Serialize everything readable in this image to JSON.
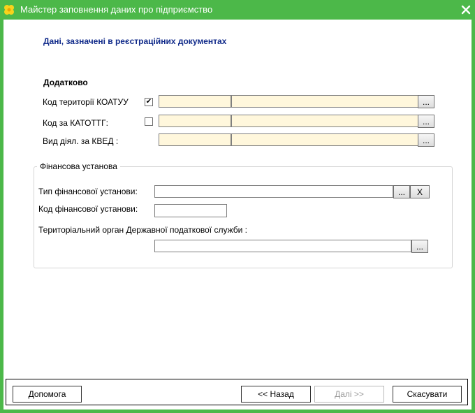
{
  "window": {
    "title": "Майстер заповнення даних про підприємство",
    "icon": "flower-icon",
    "close_glyph": "✕"
  },
  "heading": "Дані, зазначені в реєстраційних документах",
  "additional": {
    "title": "Додатково",
    "koatuu": {
      "label": "Код території КОАТУУ",
      "checked": true,
      "check_glyph": "✔",
      "code": "",
      "name": "",
      "browse_label": "..."
    },
    "katottg": {
      "label": "Код за КАТОТТГ:",
      "checked": false,
      "check_glyph": "",
      "code": "",
      "name": "",
      "browse_label": "..."
    },
    "kved": {
      "label": "Вид діял. за КВЕД :",
      "code": "",
      "name": "",
      "browse_label": "..."
    }
  },
  "financial": {
    "legend": "Фінансова установа",
    "type_label": "Тип фінансової установи:",
    "type_value": "",
    "type_browse_label": "...",
    "type_clear_label": "X",
    "code_label": "Код фінансової установи:",
    "code_value": "",
    "tax_label": "Територіальний орган Державної податкової служби :",
    "tax_value": "",
    "tax_browse_label": "..."
  },
  "footer": {
    "help_label": "Допомога",
    "back_label": "<< Назад",
    "next_label": "Далі >>",
    "cancel_label": "Скасувати"
  }
}
